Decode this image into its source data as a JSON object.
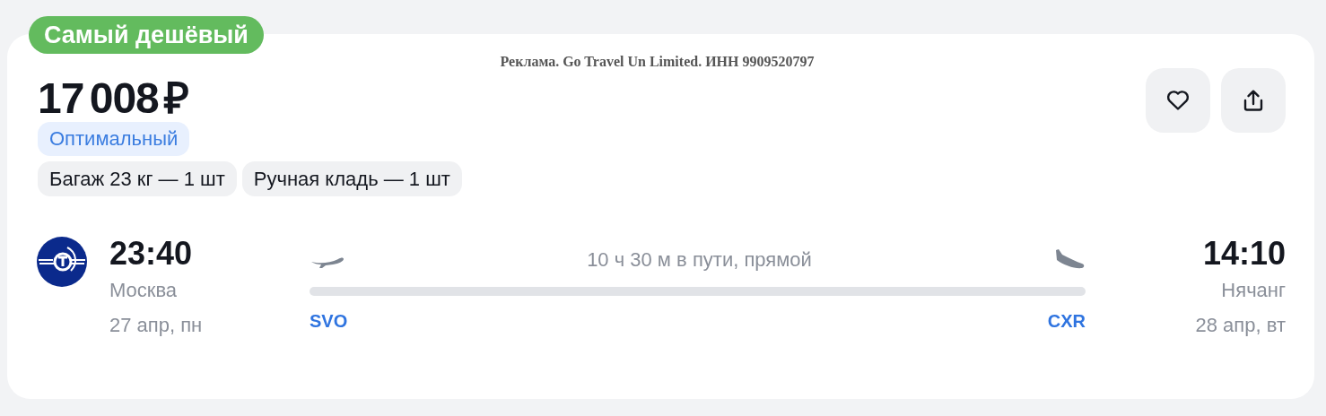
{
  "badge": "Самый дешёвый",
  "ad_notice": "Реклама. Go Travel Un Limited. ИНН 9909520797",
  "price": "17 008 ₽",
  "actions": [
    {
      "kind": "favorite"
    },
    {
      "kind": "share"
    }
  ],
  "fare_tag": "Оптимальный",
  "baggage": [
    "Багаж 23 кг — 1 шт",
    "Ручная кладь — 1 шт"
  ],
  "flight": {
    "departure": {
      "time": "23:40",
      "city": "Москва",
      "date": "27 апр, пн",
      "airport": "SVO"
    },
    "duration": "10 ч 30 м в пути, прямой",
    "arrival": {
      "time": "14:10",
      "city": "Нячанг",
      "date": "28 апр, вт",
      "airport": "CXR"
    }
  }
}
